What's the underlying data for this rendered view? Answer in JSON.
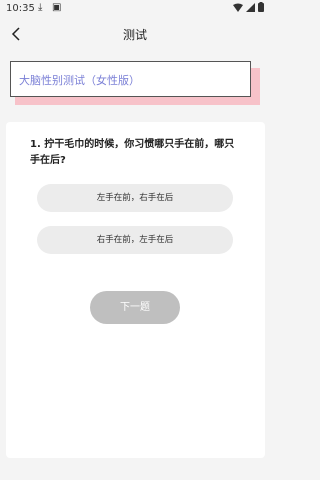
{
  "status_bar": {
    "time": "10:35"
  },
  "header": {
    "title": "测试"
  },
  "banner": {
    "text": "大脑性别测试（女性版）"
  },
  "question": {
    "text": "1. 拧干毛巾的时候，你习惯哪只手在前，哪只手在后?",
    "options": [
      {
        "label": "左手在前，右手在后"
      },
      {
        "label": "右手在前，左手在后"
      }
    ],
    "next_label": "下一题"
  },
  "colors": {
    "banner_text": "#7a7fd6",
    "banner_shadow": "#f7c2c9",
    "next_button": "#bfbfbf"
  }
}
